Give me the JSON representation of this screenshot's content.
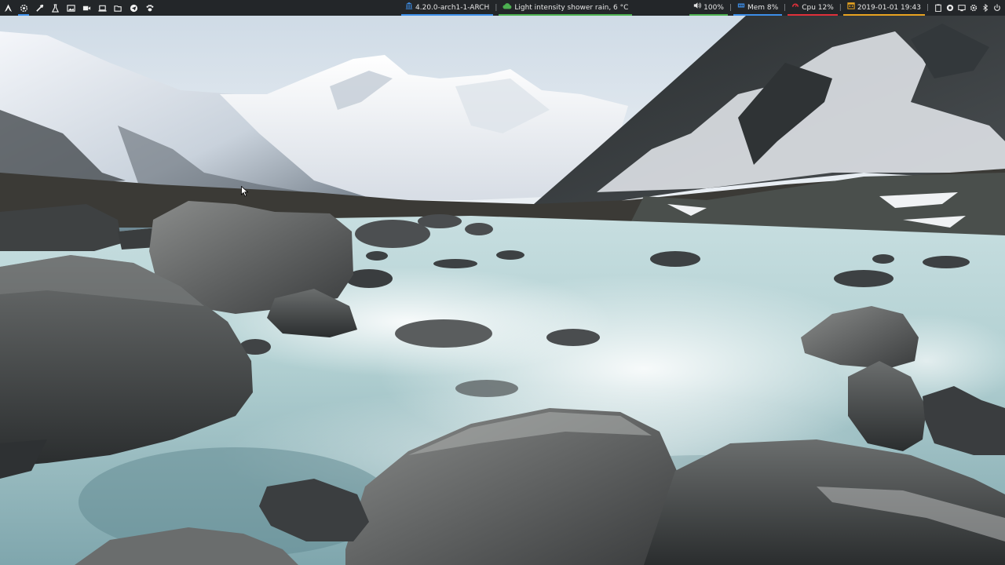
{
  "topbar": {
    "launchers": [
      {
        "icon": "arch-logo-icon"
      },
      {
        "icon": "settings-gear-icon"
      },
      {
        "icon": "color-picker-icon"
      },
      {
        "icon": "flask-icon"
      },
      {
        "icon": "image-viewer-icon"
      },
      {
        "icon": "video-camera-icon"
      },
      {
        "icon": "laptop-icon"
      },
      {
        "icon": "folder-open-icon"
      },
      {
        "icon": "telegram-icon"
      },
      {
        "icon": "paw-icon"
      }
    ],
    "kernel": {
      "text": "4.20.0-arch1-1-ARCH",
      "color": "#3d8ee8"
    },
    "weather": {
      "text": "Light intensity shower rain, 6 °C",
      "color": "#4caf50"
    },
    "volume": {
      "text": "100%",
      "color": "#4caf50"
    },
    "memory": {
      "text": "Mem 8%",
      "color": "#3d8ee8"
    },
    "cpu": {
      "text": "Cpu 12%",
      "color": "#e0303a"
    },
    "datetime": {
      "text": "2019-01-01 19:43",
      "color": "#e8a320"
    },
    "tray": [
      {
        "icon": "clipboard-icon"
      },
      {
        "icon": "record-icon"
      },
      {
        "icon": "screen-icon"
      },
      {
        "icon": "settings-icon"
      },
      {
        "icon": "bluetooth-icon"
      },
      {
        "icon": "power-icon"
      }
    ]
  }
}
